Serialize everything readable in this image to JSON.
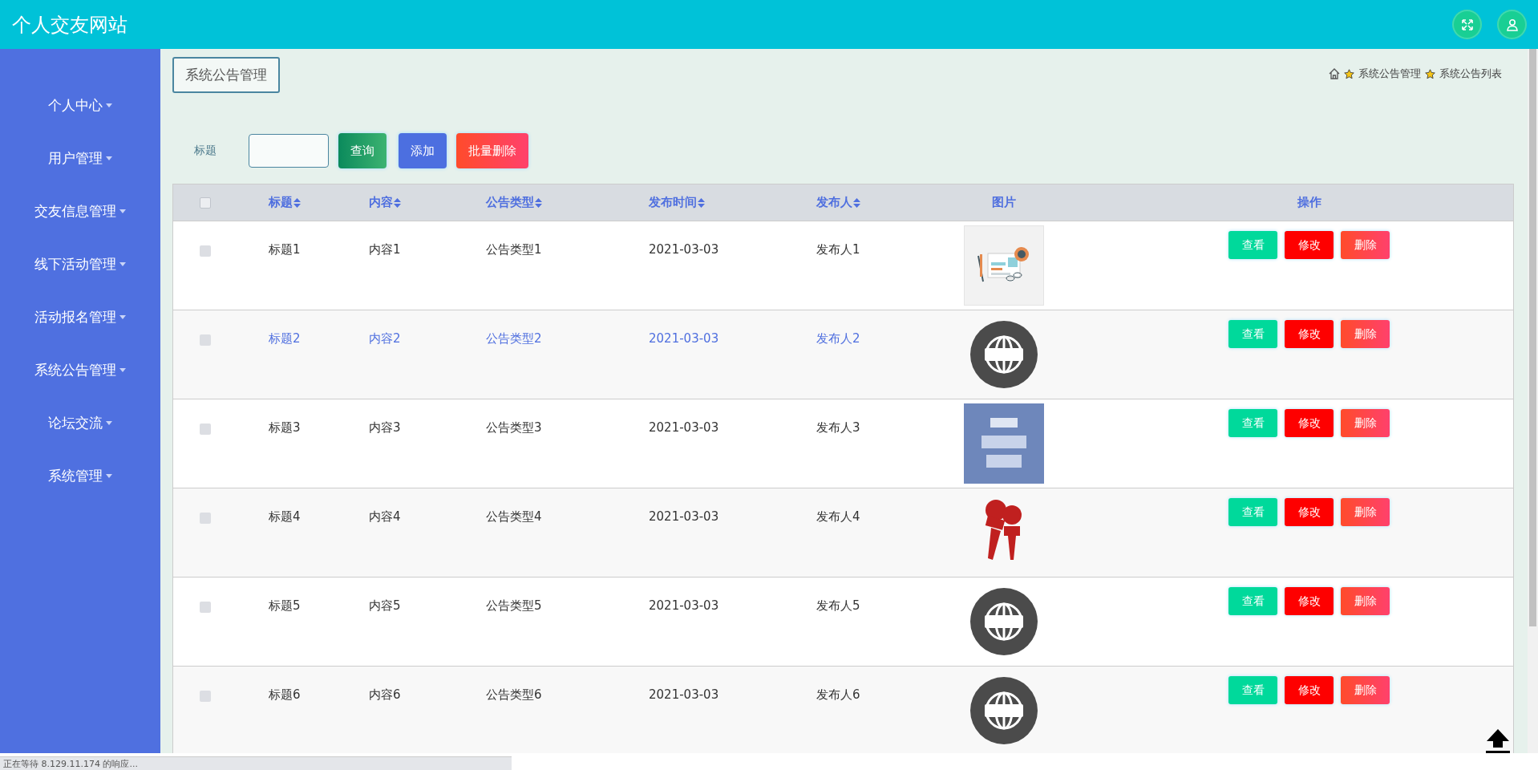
{
  "header": {
    "title": "个人交友网站"
  },
  "sidebar": {
    "items": [
      {
        "label": "个人中心"
      },
      {
        "label": "用户管理"
      },
      {
        "label": "交友信息管理"
      },
      {
        "label": "线下活动管理"
      },
      {
        "label": "活动报名管理"
      },
      {
        "label": "系统公告管理"
      },
      {
        "label": "论坛交流"
      },
      {
        "label": "系统管理"
      }
    ]
  },
  "page": {
    "title": "系统公告管理",
    "breadcrumb": [
      "系统公告管理",
      "系统公告列表"
    ]
  },
  "search": {
    "label": "标题",
    "buttons": [
      {
        "label": "查询",
        "kind": "search"
      },
      {
        "label": "添加",
        "kind": "add"
      },
      {
        "label": "批量删除",
        "kind": "delete"
      }
    ]
  },
  "table": {
    "all_checked": false,
    "columns": [
      {
        "label": "标题",
        "sortable": true
      },
      {
        "label": "内容",
        "sortable": true
      },
      {
        "label": "公告类型",
        "sortable": true
      },
      {
        "label": "发布时间",
        "sortable": true
      },
      {
        "label": "发布人",
        "sortable": true
      },
      {
        "label": "图片",
        "sortable": false
      },
      {
        "label": "操作",
        "sortable": false
      }
    ],
    "rows": [
      {
        "cells": [
          "标题1",
          "内容1",
          "公告类型1",
          "2021-03-03",
          "发布人1"
        ],
        "image": {
          "kind": "newspaper"
        },
        "checked": false,
        "hovered": false,
        "actions": [
          {
            "label": "查看",
            "kind": "view"
          },
          {
            "label": "修改",
            "kind": "edit"
          },
          {
            "label": "删除",
            "kind": "delete"
          }
        ]
      },
      {
        "cells": [
          "标题2",
          "内容2",
          "公告类型2",
          "2021-03-03",
          "发布人2"
        ],
        "image": {
          "kind": "globe"
        },
        "checked": false,
        "hovered": true,
        "actions": [
          {
            "label": "查看",
            "kind": "view"
          },
          {
            "label": "修改",
            "kind": "edit"
          },
          {
            "label": "删除",
            "kind": "delete"
          }
        ]
      },
      {
        "cells": [
          "标题3",
          "内容3",
          "公告类型3",
          "2021-03-03",
          "发布人3"
        ],
        "image": {
          "kind": "tile"
        },
        "checked": false,
        "hovered": false,
        "actions": [
          {
            "label": "查看",
            "kind": "view"
          },
          {
            "label": "修改",
            "kind": "edit"
          },
          {
            "label": "删除",
            "kind": "delete"
          }
        ]
      },
      {
        "cells": [
          "标题4",
          "内容4",
          "公告类型4",
          "2021-03-03",
          "发布人4"
        ],
        "image": {
          "kind": "microphone"
        },
        "checked": false,
        "hovered": false,
        "actions": [
          {
            "label": "查看",
            "kind": "view"
          },
          {
            "label": "修改",
            "kind": "edit"
          },
          {
            "label": "删除",
            "kind": "delete"
          }
        ]
      },
      {
        "cells": [
          "标题5",
          "内容5",
          "公告类型5",
          "2021-03-03",
          "发布人5"
        ],
        "image": {
          "kind": "globe"
        },
        "checked": false,
        "hovered": false,
        "actions": [
          {
            "label": "查看",
            "kind": "view"
          },
          {
            "label": "修改",
            "kind": "edit"
          },
          {
            "label": "删除",
            "kind": "delete"
          }
        ]
      },
      {
        "cells": [
          "标题6",
          "内容6",
          "公告类型6",
          "2021-03-03",
          "发布人6"
        ],
        "image": {
          "kind": "globe"
        },
        "checked": false,
        "hovered": false,
        "actions": [
          {
            "label": "查看",
            "kind": "view"
          },
          {
            "label": "修改",
            "kind": "edit"
          },
          {
            "label": "删除",
            "kind": "delete"
          }
        ]
      }
    ]
  },
  "status_bar": {
    "text": "正在等待 8.129.11.174 的响应..."
  }
}
